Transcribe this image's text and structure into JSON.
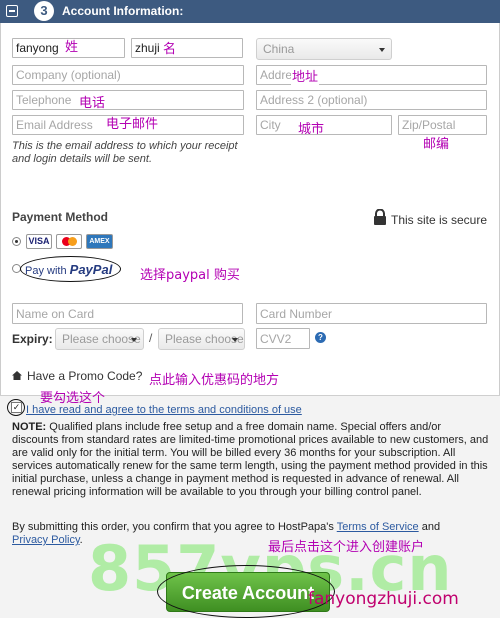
{
  "header": {
    "step_number": "3",
    "title": "Account Information:"
  },
  "account_form": {
    "first_name": {
      "value": "fanyong",
      "annotation": "姓"
    },
    "last_name": {
      "value": "zhuji",
      "annotation": "名"
    },
    "country": {
      "selected": "China"
    },
    "company": {
      "placeholder": "Company (optional)"
    },
    "address": {
      "placeholder": "Address",
      "annotation": "地址"
    },
    "telephone": {
      "placeholder": "Telephone",
      "annotation": "电话"
    },
    "address2": {
      "placeholder": "Address 2 (optional)"
    },
    "email": {
      "placeholder": "Email Address",
      "annotation": "电子邮件"
    },
    "city": {
      "placeholder": "City",
      "annotation": "城市"
    },
    "zip": {
      "placeholder": "Zip/Postal",
      "annotation": "邮编"
    },
    "email_note": "This is the email address to which your receipt and login details will be sent."
  },
  "payment": {
    "title": "Payment Method",
    "secure_text": "This site is secure",
    "cards": [
      "VISA",
      "MC",
      "AMEX"
    ],
    "paypal_prefix": "Pay",
    "paypal_with": "with",
    "paypal_brand": "PayPal",
    "paypal_annotation": "选择paypal 购买",
    "name_on_card": {
      "placeholder": "Name on Card"
    },
    "card_number": {
      "placeholder": "Card Number"
    },
    "expiry_label": "Expiry:",
    "expiry_month": "Please choose",
    "expiry_sep": "/",
    "expiry_year": "Please choose",
    "cvv": {
      "placeholder": "CVV2"
    },
    "help_icon": "?"
  },
  "promo": {
    "label": "Have a Promo Code?",
    "annotation": "点此输入优惠码的地方"
  },
  "terms": {
    "annotation": "要勾选这个",
    "checkbox_text": "I have read and agree to the terms and conditions of use",
    "note_label": "NOTE:",
    "note_text": "Qualified plans include free setup and a free domain name. Special offers and/or discounts from standard rates are limited-time promotional prices available to new customers, and are valid only for the initial term. You will be billed every 36 months for your subscription. All services automatically renew for the same term length, using the payment method provided in this initial purchase, unless a change in payment method is requested in advance of renewal. All renewal pricing information will be available to you through your billing control panel.",
    "submit_prefix": "By submitting this order, you confirm that you agree to HostPapa's ",
    "tos_link": "Terms of Service",
    "and": " and",
    "privacy_link": "Privacy Policy",
    "period": "."
  },
  "submit": {
    "annotation": "最后点击这个进入创建账户",
    "button_label": "Create Account"
  },
  "watermark": {
    "text": "857vps.cn",
    "site": "fanyongzhuji.com"
  },
  "colors": {
    "header_bg": "#3d5a80",
    "annotation": "#b300b3",
    "button": "#4fa32e"
  }
}
